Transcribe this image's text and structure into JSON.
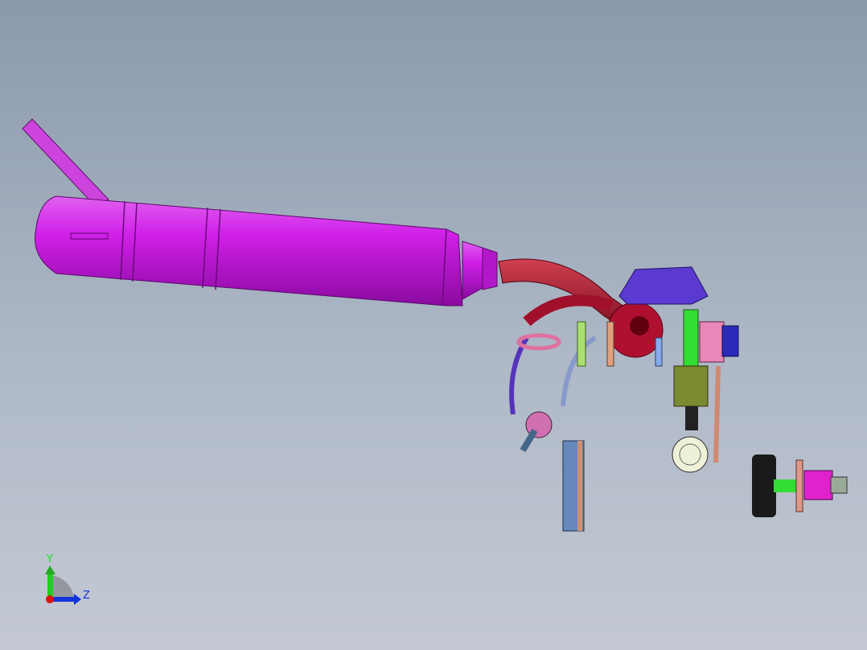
{
  "viewport": {
    "triad": {
      "y_label": "Y",
      "z_label": "Z"
    },
    "colors": {
      "muffler": "#cc22dd",
      "exhaust_pipe": "#a0102a",
      "tank": "#5533cc",
      "y_axis": "#22cc22",
      "z_axis": "#1133dd",
      "x_axis": "#dd1111"
    }
  }
}
